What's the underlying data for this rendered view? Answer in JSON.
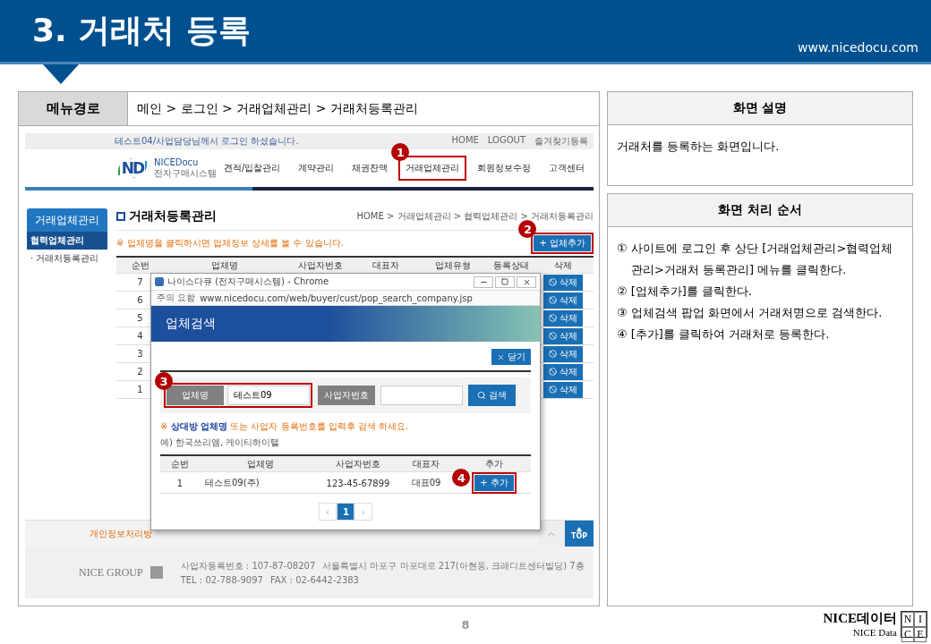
{
  "header": {
    "title": "3. 거래처 등록",
    "url": "www.nicedocu.com"
  },
  "menu_path": {
    "label": "메뉴경로",
    "path": "메인 > 로그인 > 거래업체관리 > 거래처등록관리"
  },
  "screenshot": {
    "top_bar": {
      "login_message": "테스트04/사업담당님께서 로그인 하셨습니다.",
      "links": [
        "HOME",
        "LOGOUT",
        "즐겨찾기등록"
      ]
    },
    "logo": {
      "mark": "ND",
      "name": "NICEDocu",
      "subtitle": "전자구매시스템"
    },
    "nav": [
      {
        "label": "견적/입찰관리",
        "highlighted": false
      },
      {
        "label": "계약관리",
        "highlighted": false
      },
      {
        "label": "채권잔액",
        "highlighted": false
      },
      {
        "label": "거래업체관리",
        "highlighted": true,
        "callout": "1"
      },
      {
        "label": "회원정보수정",
        "highlighted": false
      },
      {
        "label": "고객센터",
        "highlighted": false
      }
    ],
    "sidebar": {
      "title": "거래업체관리",
      "items": [
        {
          "label": "협력업체관리",
          "kind": "group"
        },
        {
          "label": "· 거래처등록관리",
          "kind": "link"
        }
      ]
    },
    "page_title": "거래처등록관리",
    "breadcrumb": "HOME > 거래업체관리 > 협력업체관리 > 거래처등록관리",
    "notice": "※ 업체명을 클릭하시면 업체정보 상세를 볼 수 있습니다.",
    "add_button": {
      "label": "+ 업체추가",
      "highlighted": true,
      "callout": "2"
    },
    "table": {
      "columns": [
        "순번",
        "업체명",
        "사업자번호",
        "대표자",
        "업체유형",
        "등록상태",
        "삭제"
      ],
      "rows": [
        {
          "no": "7",
          "delete": "삭제"
        },
        {
          "no": "6",
          "delete": "삭제"
        },
        {
          "no": "5",
          "delete": "삭제"
        },
        {
          "no": "4",
          "delete": "삭제"
        },
        {
          "no": "3",
          "delete": "삭제"
        },
        {
          "no": "2",
          "delete": "삭제"
        },
        {
          "no": "1",
          "delete": "삭제"
        }
      ]
    },
    "footer": {
      "link": "개인정보처리방",
      "top_button": "TOP",
      "group": "NICE GROUP",
      "info": [
        "사업자등록번호 : 107-87-08207",
        "서울특별시 마포구 마포대로 217(아현동, 크레디트센터빌딩) 7층"
      ],
      "contact": [
        "TEL : 02-788-9097",
        "FAX : 02-6442-2383"
      ]
    },
    "popup": {
      "window_title": "나이스다큐 (전자구매시스템) - Chrome",
      "security": "주의 요함",
      "url": "www.nicedocu.com/web/buyer/cust/pop_search_company.jsp",
      "title": "업체검색",
      "close_button": "닫기",
      "search": {
        "name_label": "업체명",
        "name_value": "테스트09",
        "highlighted": true,
        "callout": "3",
        "number_label": "사업자번호",
        "button": "검색"
      },
      "notice": "※ **상대방 업체명** 또는 사업자 등록번호를 입력후 검색 하세요.",
      "example": "예) 한국쓰리엠, 케이티하이텔",
      "table": {
        "columns": [
          "순번",
          "업체명",
          "사업자번호",
          "대표자",
          "추가"
        ],
        "rows": [
          {
            "cells": [
              "1",
              "테스트09(주)",
              "123-45-67899",
              "대표09"
            ],
            "button": "+ 추가",
            "highlighted": true,
            "callout": "4"
          }
        ]
      },
      "pagination": {
        "prev": "‹",
        "pages": [
          {
            "label": "1",
            "selected": true
          }
        ],
        "next": "›"
      }
    }
  },
  "description": {
    "title": "화면 설명",
    "text": "거래처를 등록하는 화면입니다."
  },
  "procedure": {
    "title": "화면 처리 순서",
    "steps": [
      "① 사이트에 로그인 후 상단 [거래업체관리>협력업체관리>거래처 등록관리] 메뉴를 클릭한다.",
      "② [업체추가]를 클릭한다.",
      "③ 업체검색 팝업 화면에서 거래처명으로 검색한다.",
      "④ [추가]를 클릭하여 거래처로 등록한다."
    ]
  },
  "page_number": "8",
  "brand": {
    "korean": "NICE데이터",
    "english": "NICE Data",
    "mark": [
      "N",
      "I",
      "C",
      "E"
    ]
  }
}
